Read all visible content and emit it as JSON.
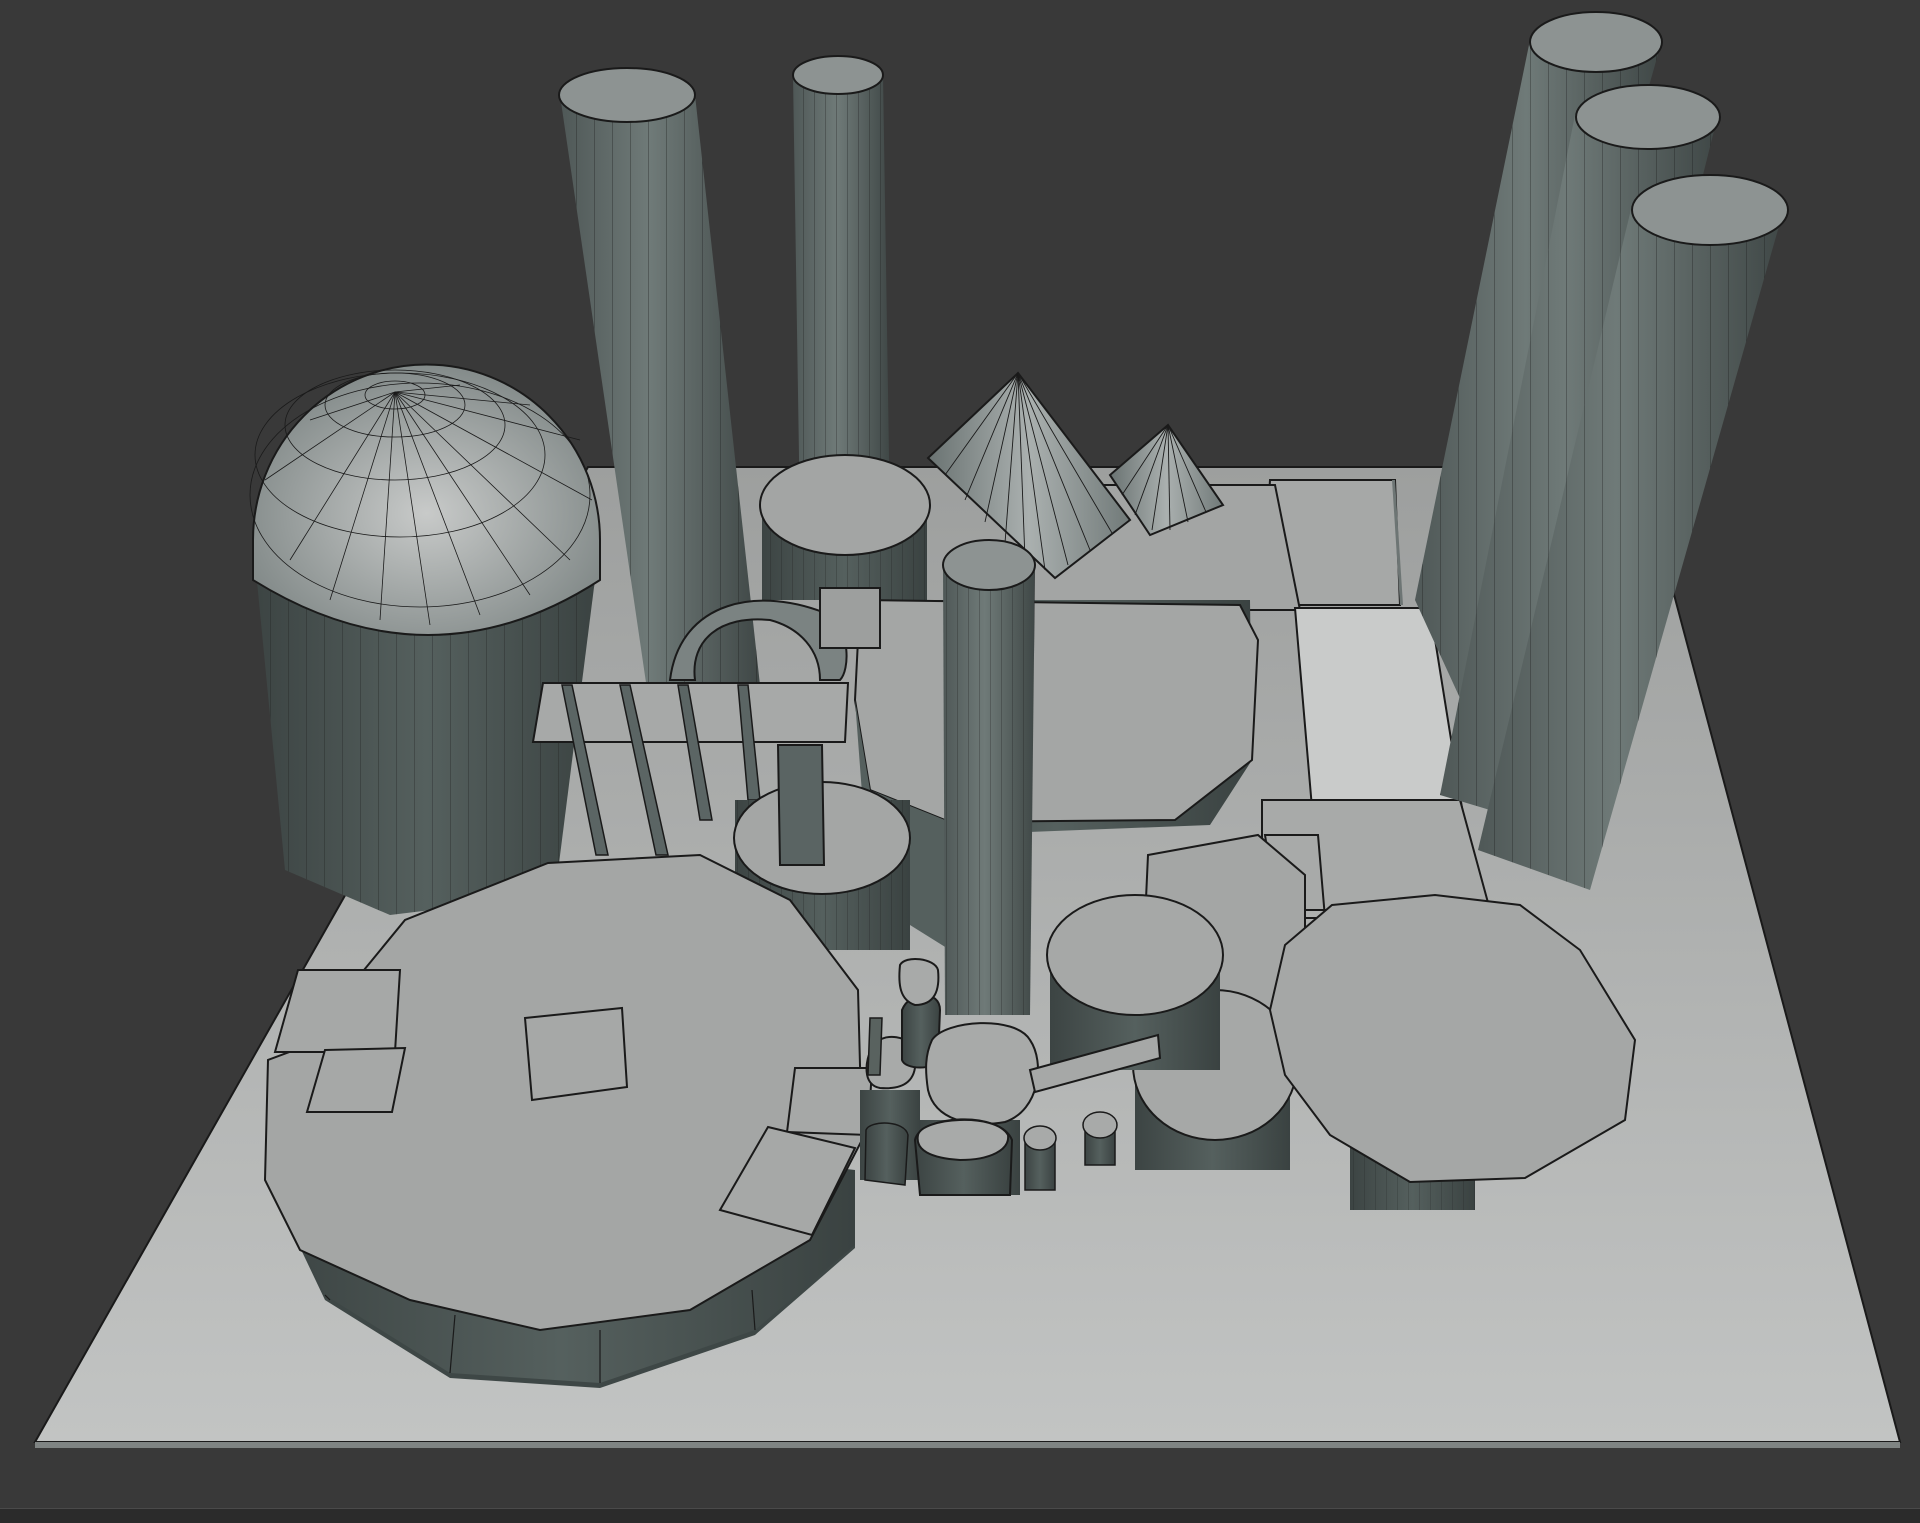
{
  "viewport": {
    "background": "#393939",
    "ground_color": "#b4b6b5",
    "object_top_color": "#a4a6a5",
    "object_side_color": "#5c6664",
    "wire_color": "#1a1a1a"
  },
  "statusbar": {}
}
